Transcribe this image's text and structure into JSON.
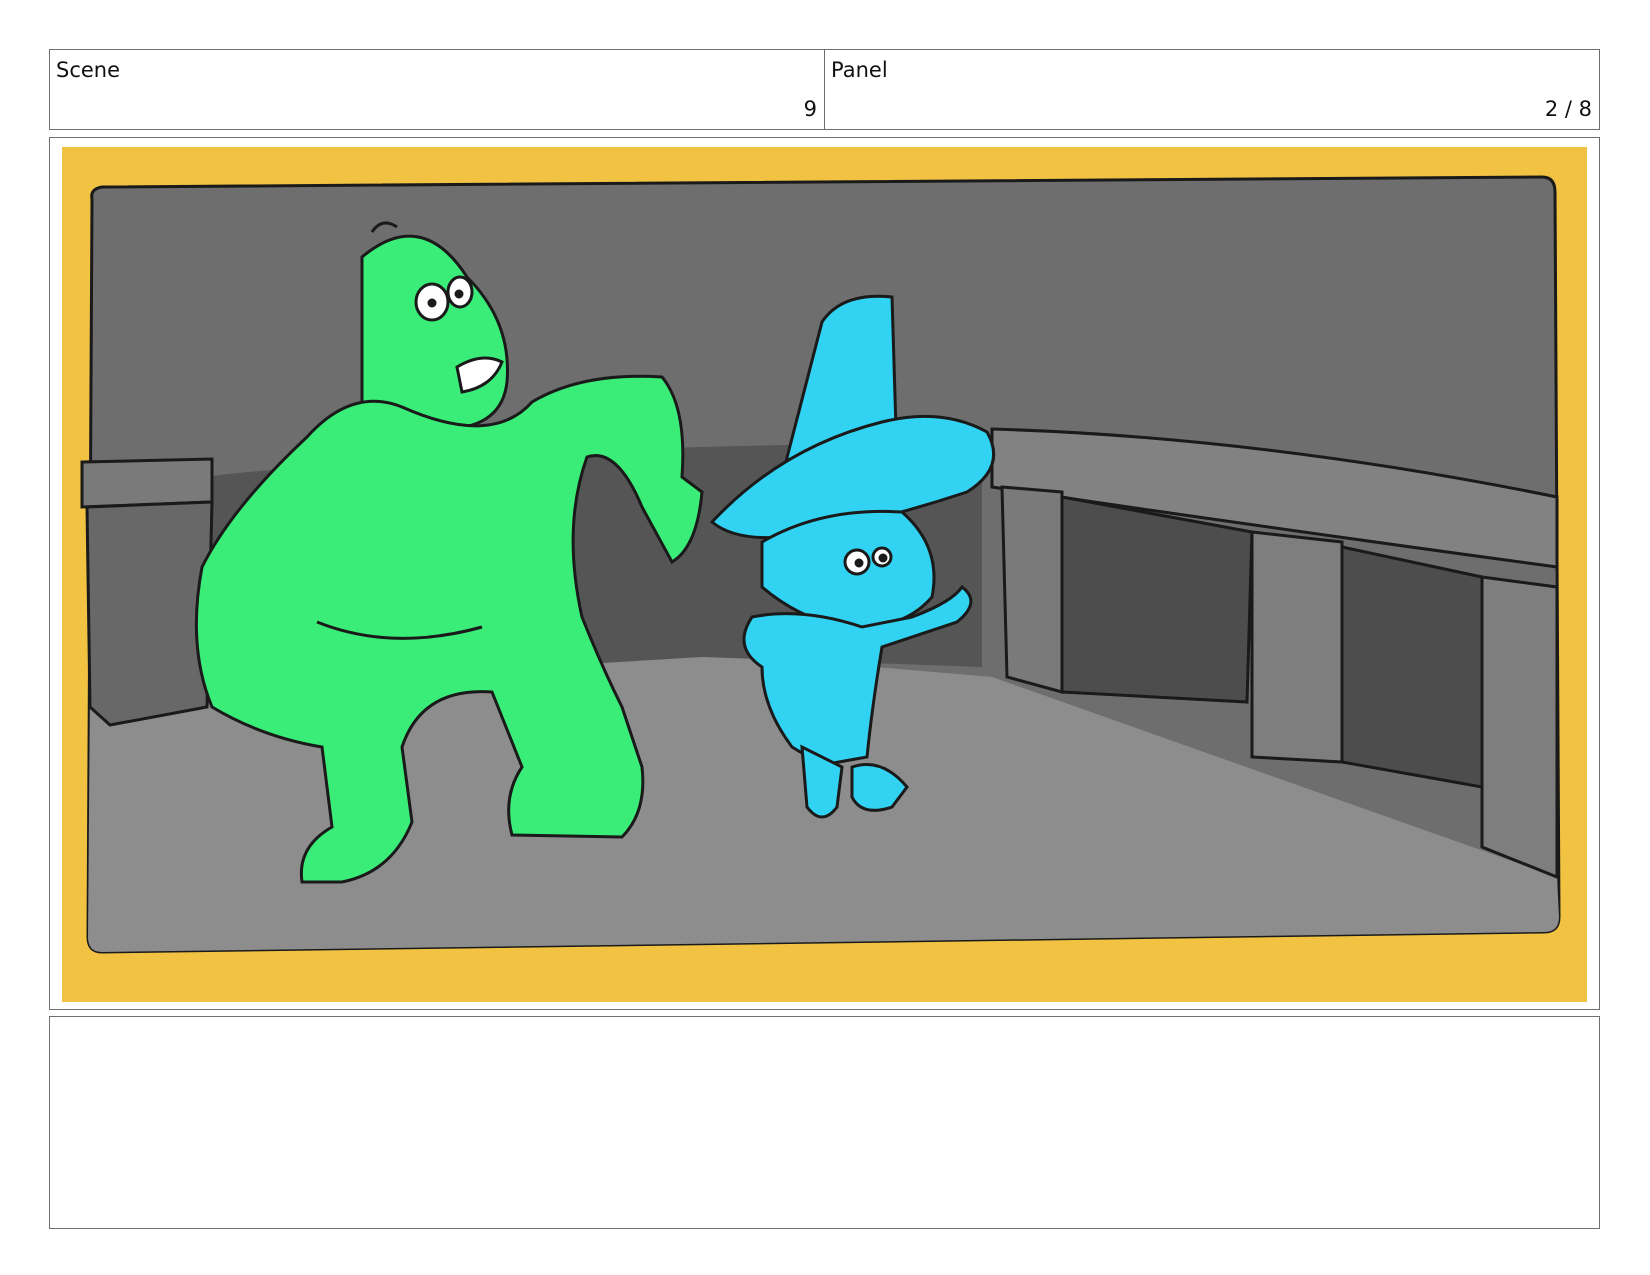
{
  "scene": {
    "label": "Scene",
    "value": "9"
  },
  "panel": {
    "label": "Panel",
    "value": "2 / 8"
  },
  "notes": {
    "text": ""
  },
  "colors": {
    "frame_border": "#f2c343",
    "background_wall": "#6e6e6e",
    "floor": "#8e8e8e",
    "green_character": "#3aec78",
    "blue_character": "#32d2f2",
    "outline": "#1a1a1a"
  }
}
